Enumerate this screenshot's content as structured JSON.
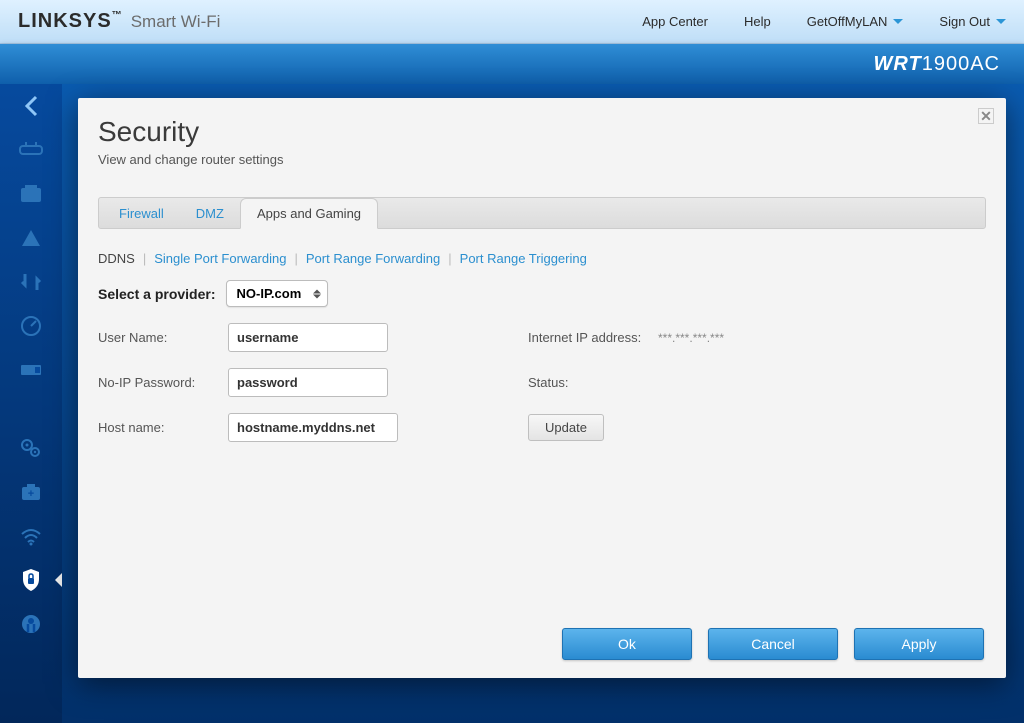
{
  "brand": {
    "logo": "LINKSYS",
    "tm": "™",
    "sub": "Smart Wi-Fi"
  },
  "topnav": {
    "app_center": "App Center",
    "help": "Help",
    "account": "GetOffMyLAN",
    "signout": "Sign Out"
  },
  "model": {
    "bold": "WRT",
    "rest": "1900AC"
  },
  "panel": {
    "title": "Security",
    "subtitle": "View and change router settings"
  },
  "tabs": {
    "firewall": "Firewall",
    "dmz": "DMZ",
    "apps": "Apps and Gaming"
  },
  "subnav": {
    "ddns": "DDNS",
    "spf": "Single Port Forwarding",
    "prf": "Port Range Forwarding",
    "prt": "Port Range Triggering"
  },
  "form": {
    "provider_label": "Select a provider:",
    "provider_value": "NO-IP.com",
    "username_label": "User Name:",
    "username_value": "username",
    "password_label": "No-IP Password:",
    "password_value": "password",
    "hostname_label": "Host name:",
    "hostname_value": "hostname.myddns.net",
    "ip_label": "Internet IP address:",
    "ip_value": "***.***.***.***",
    "status_label": "Status:",
    "status_value": "",
    "update_btn": "Update"
  },
  "footer": {
    "ok": "Ok",
    "cancel": "Cancel",
    "apply": "Apply"
  }
}
